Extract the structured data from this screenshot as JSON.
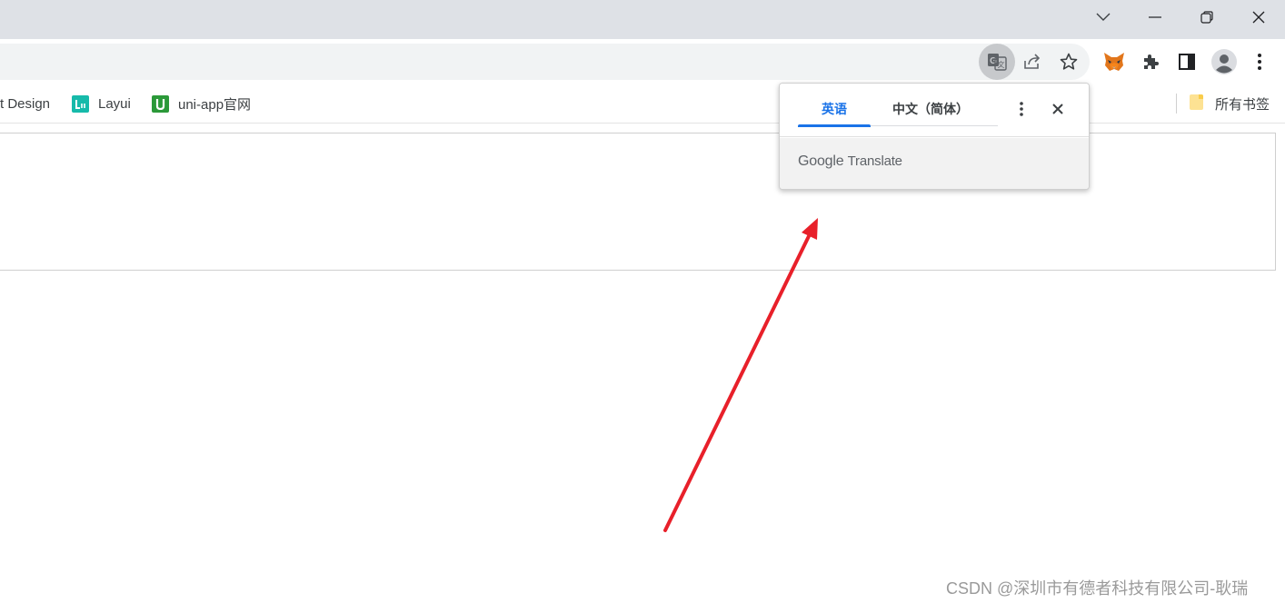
{
  "window": {
    "controls": [
      "chevron-down-icon",
      "minimize-icon",
      "restore-icon",
      "close-icon"
    ]
  },
  "toolbar": {
    "icons": [
      "translate-icon",
      "share-icon",
      "star-icon",
      "metamask-fox-icon",
      "extensions-icon",
      "side-panel-icon",
      "profile-avatar-icon",
      "more-menu-icon"
    ]
  },
  "bookmarks": {
    "items": [
      {
        "label": "t Design"
      },
      {
        "label": "Layui",
        "favicon_color": "#16baaa"
      },
      {
        "label": "uni-app官网",
        "favicon_color": "#2b9939"
      }
    ],
    "all_bookmarks_label": "所有书签"
  },
  "translate_popup": {
    "tabs": [
      {
        "label": "英语",
        "selected": true
      },
      {
        "label": "中文（简体）",
        "selected": false
      }
    ],
    "brand_google": "Google",
    "brand_translate": "Translate",
    "accent_color": "#1a73e8"
  },
  "annotation": {
    "arrow_color": "#e8202a"
  },
  "watermark": "CSDN @深圳市有德者科技有限公司-耿瑞"
}
